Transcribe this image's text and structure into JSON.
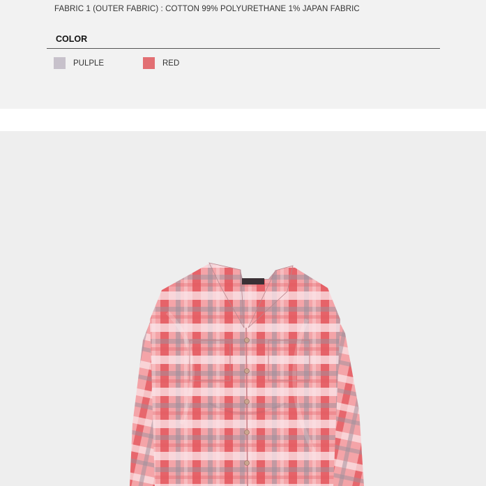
{
  "details": {
    "fabric_text": "FABRIC 1 (OUTER FABRIC) : COTTON 99% POLYURETHANE 1% JAPAN FABRIC"
  },
  "colors": {
    "heading": "COLOR",
    "options": [
      {
        "label": "PULPLE",
        "hex": "#c7c1cb"
      },
      {
        "label": "RED",
        "hex": "#e26f73"
      }
    ]
  },
  "product_image": {
    "subject": "shirt-photo",
    "palette": {
      "background": "#eeeeee",
      "base": "#f4a4a8",
      "stripe": "#e4585e",
      "light": "#fbe7ea",
      "grey": "#9b8f9c",
      "button": "#c9a58e"
    }
  }
}
